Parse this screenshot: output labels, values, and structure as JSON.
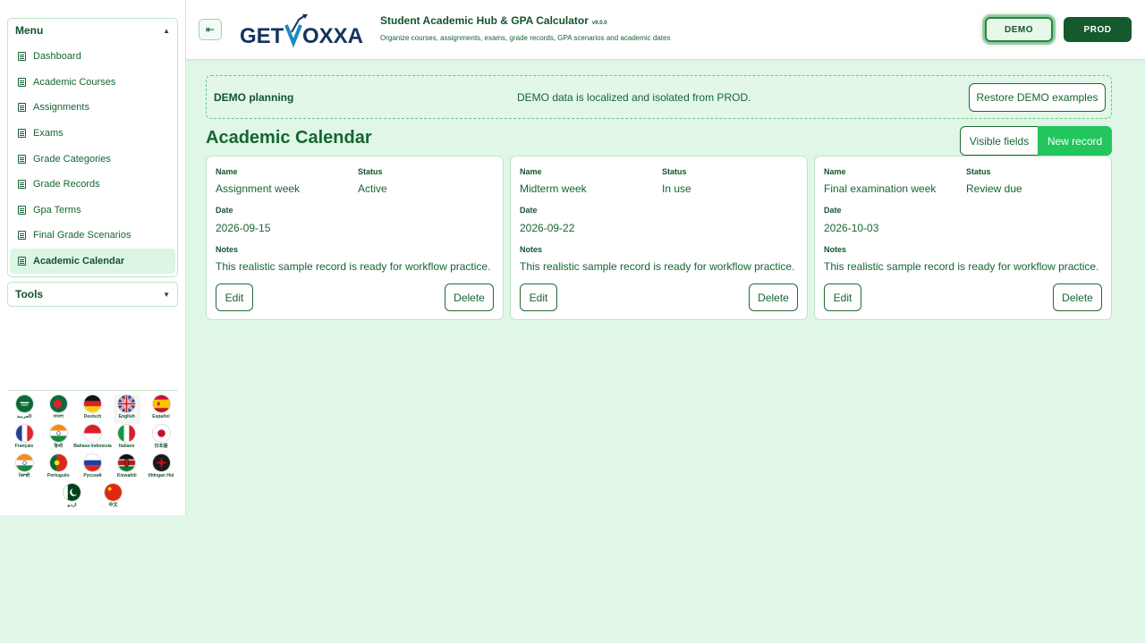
{
  "sidebar": {
    "menu_title": "Menu",
    "items": [
      {
        "label": "Dashboard"
      },
      {
        "label": "Academic Courses"
      },
      {
        "label": "Assignments"
      },
      {
        "label": "Exams"
      },
      {
        "label": "Grade Categories"
      },
      {
        "label": "Grade Records"
      },
      {
        "label": "Gpa Terms"
      },
      {
        "label": "Final Grade Scenarios"
      },
      {
        "label": "Academic Calendar"
      }
    ],
    "active_item": "Academic Calendar",
    "tools_title": "Tools",
    "languages": [
      {
        "label": "العربية",
        "icon": "saudi-flag-icon"
      },
      {
        "label": "বাংলা",
        "icon": "bangladesh-flag-icon"
      },
      {
        "label": "Deutsch",
        "icon": "germany-flag-icon"
      },
      {
        "label": "English",
        "icon": "uk-flag-icon"
      },
      {
        "label": "Español",
        "icon": "spain-flag-icon"
      },
      {
        "label": "Français",
        "icon": "france-flag-icon"
      },
      {
        "label": "हिन्दी",
        "icon": "india-flag-icon"
      },
      {
        "label": "Bahasa Indonesia",
        "icon": "indonesia-flag-icon"
      },
      {
        "label": "Italiano",
        "icon": "italy-flag-icon"
      },
      {
        "label": "日本語",
        "icon": "japan-flag-icon"
      },
      {
        "label": "ਪੰਜਾਬੀ",
        "icon": "india-flag-icon"
      },
      {
        "label": "Português",
        "icon": "portugal-flag-icon"
      },
      {
        "label": "Русский",
        "icon": "russia-flag-icon"
      },
      {
        "label": "Kiswahili",
        "icon": "kenya-flag-icon"
      },
      {
        "label": "tlhIngan Hol",
        "icon": "klingon-flag-icon"
      },
      {
        "label": "اردو",
        "icon": "pakistan-flag-icon"
      },
      {
        "label": "中文",
        "icon": "china-flag-icon"
      }
    ]
  },
  "header": {
    "logo_text_1": "GET",
    "logo_text_2": "OXXA",
    "title": "Student Academic Hub & GPA Calculator",
    "version": "v9.0.0",
    "subtitle": "Organize courses, assignments, exams, grade records, GPA scenarios and academic dates",
    "demo_label": "DEMO",
    "prod_label": "PROD"
  },
  "banner": {
    "title": "DEMO planning",
    "message": "DEMO data is localized and isolated from PROD.",
    "restore_label": "Restore DEMO examples"
  },
  "section": {
    "title": "Academic Calendar",
    "visible_fields_label": "Visible fields",
    "new_record_label": "New record"
  },
  "labels": {
    "name": "Name",
    "status": "Status",
    "date": "Date",
    "notes": "Notes",
    "edit": "Edit",
    "delete": "Delete"
  },
  "records": [
    {
      "name": "Assignment week",
      "status": "Active",
      "date": "2026-09-15",
      "notes": "This realistic sample record is ready for workflow practice."
    },
    {
      "name": "Midterm week",
      "status": "In use",
      "date": "2026-09-22",
      "notes": "This realistic sample record is ready for workflow practice."
    },
    {
      "name": "Final examination week",
      "status": "Review due",
      "date": "2026-10-03",
      "notes": "This realistic sample record is ready for workflow practice."
    }
  ],
  "colors": {
    "background": "#e0f7e7",
    "primary_dark": "#145a2c",
    "accent_green": "#22c55e",
    "text_green": "#166534"
  }
}
